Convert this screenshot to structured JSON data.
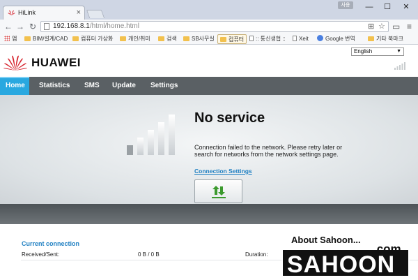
{
  "browser": {
    "tab_title": "HiLink",
    "profile_label": "사용",
    "url_host": "192.168.8.1",
    "url_path": "/html/home.html",
    "bookmarks": [
      "앱",
      "BIM/설계/CAD",
      "컴퓨터 가상화",
      "개인/취미",
      "검색",
      "SB사무실",
      "컴퓨터",
      ":: 통신생협 ::",
      "Xeit",
      "Google 번역",
      "기타 북마크"
    ]
  },
  "header": {
    "brand": "HUAWEI",
    "language": "English"
  },
  "nav": {
    "items": [
      "Home",
      "Statistics",
      "SMS",
      "Update",
      "Settings"
    ],
    "active": "Home"
  },
  "status": {
    "title": "No service",
    "message": "Connection failed to the network. Please retry later or search for networks from the network settings page.",
    "link": "Connection Settings"
  },
  "connection": {
    "heading": "Current connection",
    "received_sent_label": "Received/Sent:",
    "received_sent_value": "0 B / 0 B",
    "duration_label": "Duration:"
  },
  "watermark": {
    "top": "About Sahoon...",
    "domain": ".com",
    "name": "SAHOON"
  },
  "colors": {
    "accent": "#29a8e0",
    "nav_bg": "#5a6064",
    "link": "#1e7fc2",
    "brand_red": "#d6212b"
  }
}
